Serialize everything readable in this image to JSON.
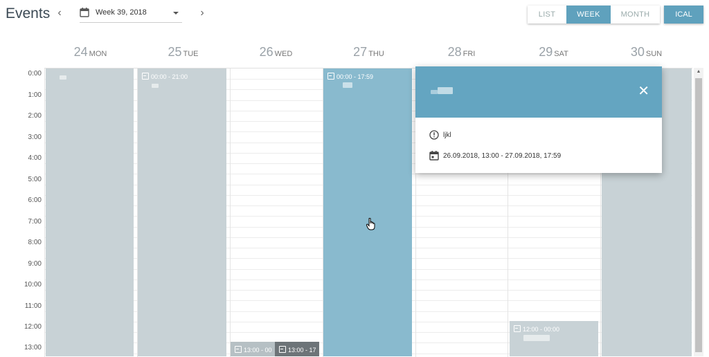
{
  "header": {
    "title": "Events",
    "week_label": "Week 39, 2018",
    "prev_icon": "chevron-left-icon",
    "next_icon": "chevron-right-icon",
    "calendar_icon": "calendar-icon"
  },
  "views": {
    "list": "LIST",
    "week": "WEEK",
    "month": "MONTH",
    "active": "WEEK",
    "ical": "ICAL"
  },
  "days": [
    {
      "num": "24",
      "dow": "MON"
    },
    {
      "num": "25",
      "dow": "TUE"
    },
    {
      "num": "26",
      "dow": "WED"
    },
    {
      "num": "27",
      "dow": "THU"
    },
    {
      "num": "28",
      "dow": "FRI"
    },
    {
      "num": "29",
      "dow": "SAT"
    },
    {
      "num": "30",
      "dow": "SUN"
    }
  ],
  "hours": [
    "0:00",
    "1:00",
    "2:00",
    "3:00",
    "4:00",
    "5:00",
    "6:00",
    "7:00",
    "8:00",
    "9:00",
    "10:00",
    "11:00",
    "12:00",
    "13:00"
  ],
  "events": {
    "tue": "00:00 - 21:00",
    "thu": "00:00 - 17:59",
    "sat": "12:00 - 00:00",
    "wed_a": "13:00 - 00",
    "wed_b": "13:00 - 17"
  },
  "popup": {
    "description": "ljkl",
    "date_range": "26.09.2018, 13:00 - 27.09.2018, 17:59",
    "close_icon": "close-icon",
    "info_icon": "info-icon",
    "calendar_icon": "calendar-icon"
  },
  "colors": {
    "accent": "#5fa1bd",
    "popup_header": "#64a5c1",
    "event_gray": "#c8d2d6",
    "event_blue": "#89bace",
    "event_dark": "#6d7478"
  }
}
